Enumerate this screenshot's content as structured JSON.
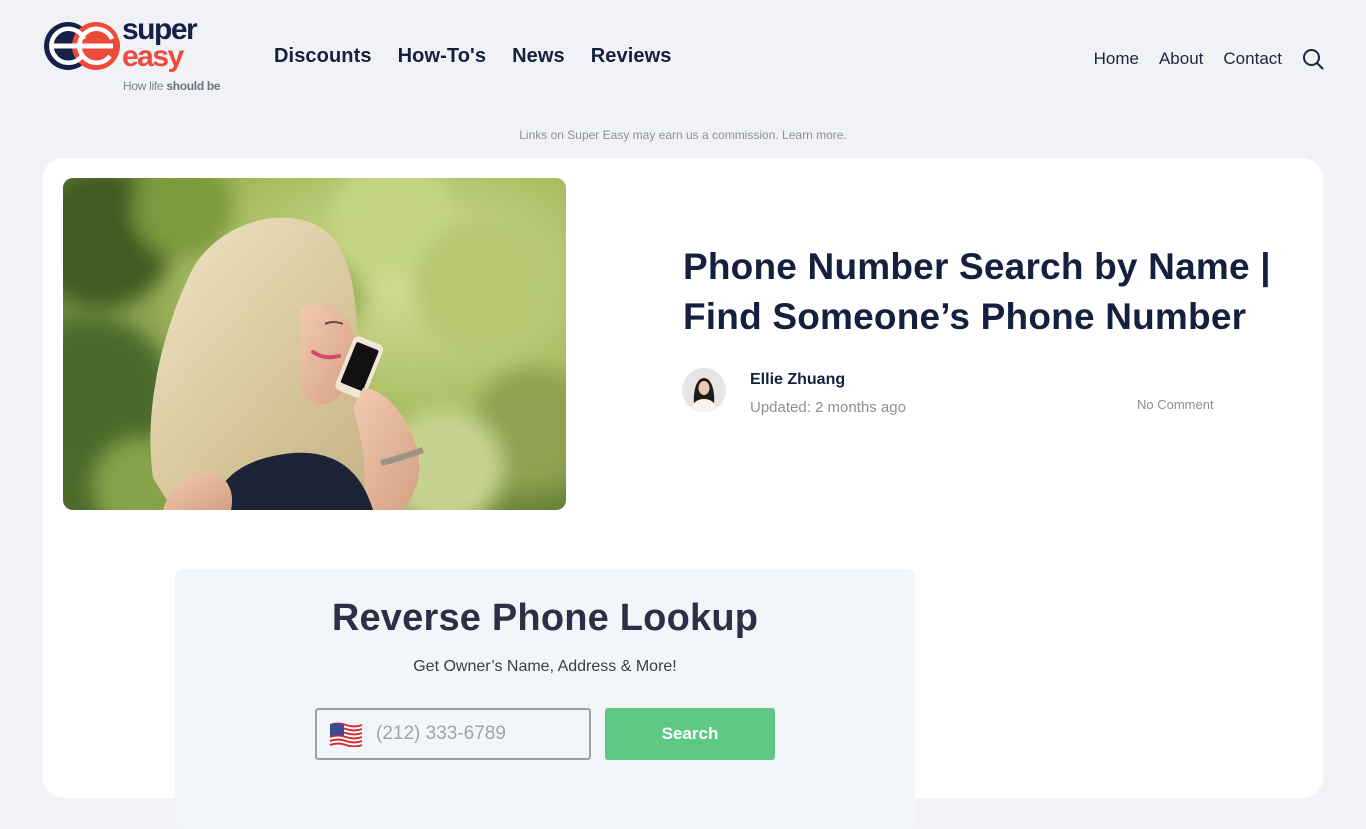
{
  "brand": {
    "name_line1": "super",
    "name_line2": "easy",
    "tagline_prefix": "How life ",
    "tagline_bold": "should be",
    "colors": {
      "navy": "#16214a",
      "coral": "#ee4a3b"
    }
  },
  "main_nav": [
    {
      "label": "Discounts"
    },
    {
      "label": "How-To's"
    },
    {
      "label": "News"
    },
    {
      "label": "Reviews"
    }
  ],
  "secondary_nav": [
    {
      "label": "Home"
    },
    {
      "label": "About"
    },
    {
      "label": "Contact"
    }
  ],
  "search_icon": "search-icon",
  "disclaimer": {
    "text": "Links on Super Easy may earn us a commission.",
    "link": "Learn more."
  },
  "article": {
    "image_alt": "Woman with blonde hair talking on a smartphone outdoors",
    "title": "Phone Number Search by Name | Find Someone’s Phone Number",
    "author": {
      "name": "Ellie Zhuang",
      "updated": "Updated: 2 months ago"
    },
    "comments": "No Comment"
  },
  "lookup_widget": {
    "title": "Reverse Phone Lookup",
    "subtitle": "Get Owner’s Name, Address & More!",
    "flag_icon": "us-flag-icon",
    "phone_placeholder": "(212) 333-6789",
    "phone_value": "",
    "button_label": "Search",
    "button_color": "#5ec884"
  }
}
